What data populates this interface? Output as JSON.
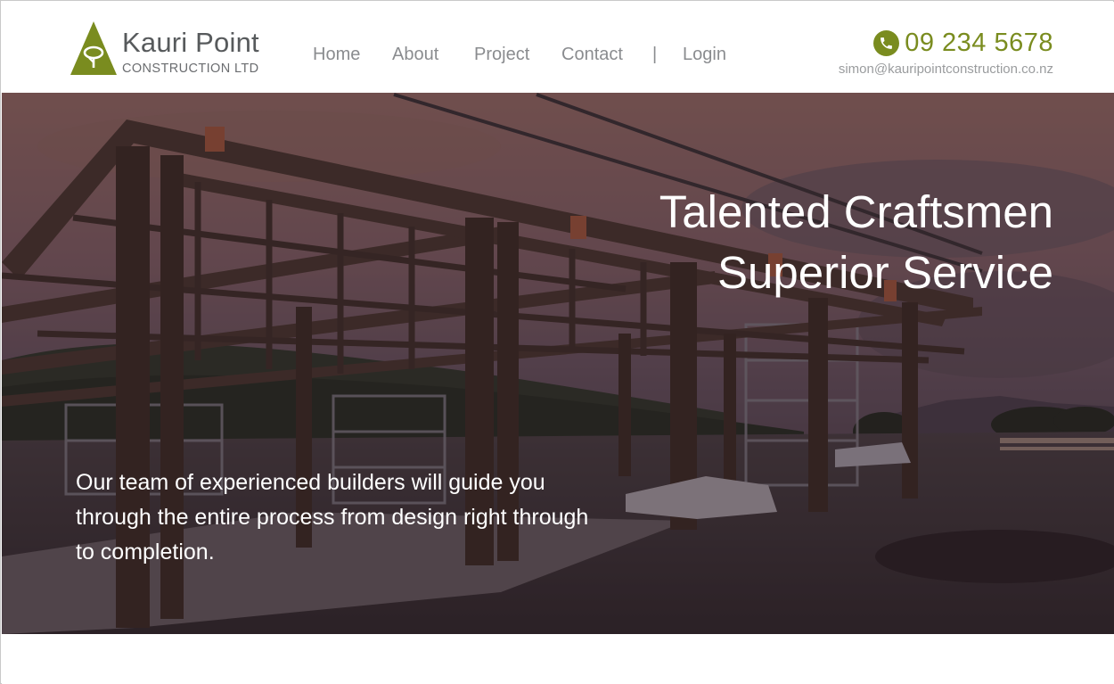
{
  "brand": {
    "name": "Kauri Point",
    "subtitle": "CONSTRUCTION LTD",
    "color": "#7a8c1f"
  },
  "nav": {
    "items": [
      {
        "label": "Home"
      },
      {
        "label": "About"
      },
      {
        "label": "Project"
      },
      {
        "label": "Contact"
      }
    ],
    "separator": "|",
    "login": "Login"
  },
  "contact": {
    "phone_icon": "phone-icon",
    "phone": "09 234 5678",
    "email": "simon@kauripointconstruction.co.nz"
  },
  "hero": {
    "headline_line1": "Talented Craftsmen",
    "headline_line2": "Superior Service",
    "tagline": "Our team of experienced builders will guide you through the entire process from design right through to completion."
  }
}
